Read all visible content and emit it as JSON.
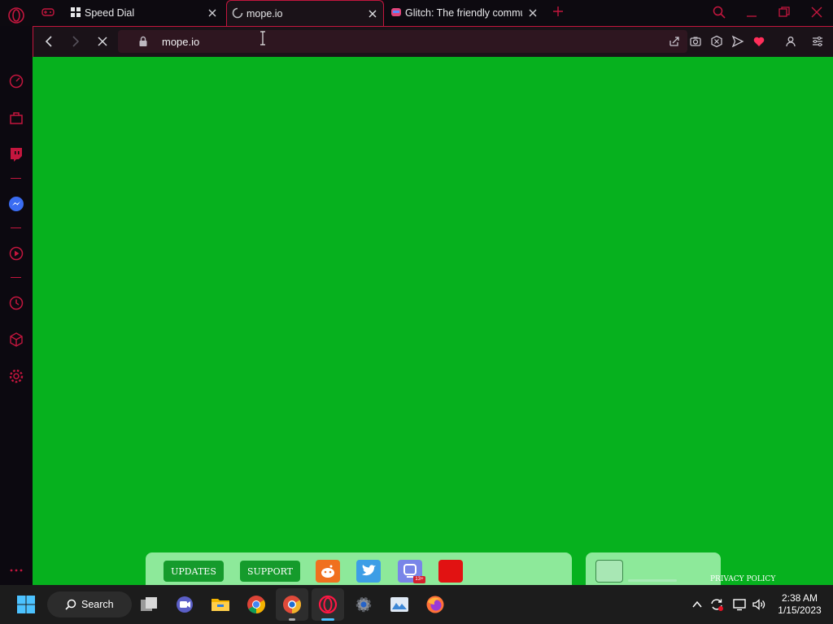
{
  "browser": {
    "tabs": [
      {
        "title": "Speed Dial",
        "active": false
      },
      {
        "title": "mope.io",
        "active": true,
        "loading": true
      },
      {
        "title": "Glitch: The friendly commu",
        "active": false
      }
    ],
    "address": {
      "url": "mope.io"
    },
    "accent": "#c4163e"
  },
  "sidebar": {
    "items": [
      "speedometer-icon",
      "bag-icon",
      "twitch-icon",
      "messenger-icon",
      "player-icon",
      "history-icon",
      "cube-icon",
      "settings-icon",
      "more-icon"
    ]
  },
  "page": {
    "background": "#06b11e",
    "buttons": {
      "updates": "UPDATES",
      "support": "SUPPORT"
    },
    "socials": [
      "reddit-icon",
      "twitter-icon",
      "discord-icon",
      "youtube-icon"
    ],
    "discord_badge": "13+",
    "privacy": "PRIVACY POLICY"
  },
  "taskbar": {
    "search_label": "Search",
    "time": "2:38 AM",
    "date": "1/15/2023"
  }
}
